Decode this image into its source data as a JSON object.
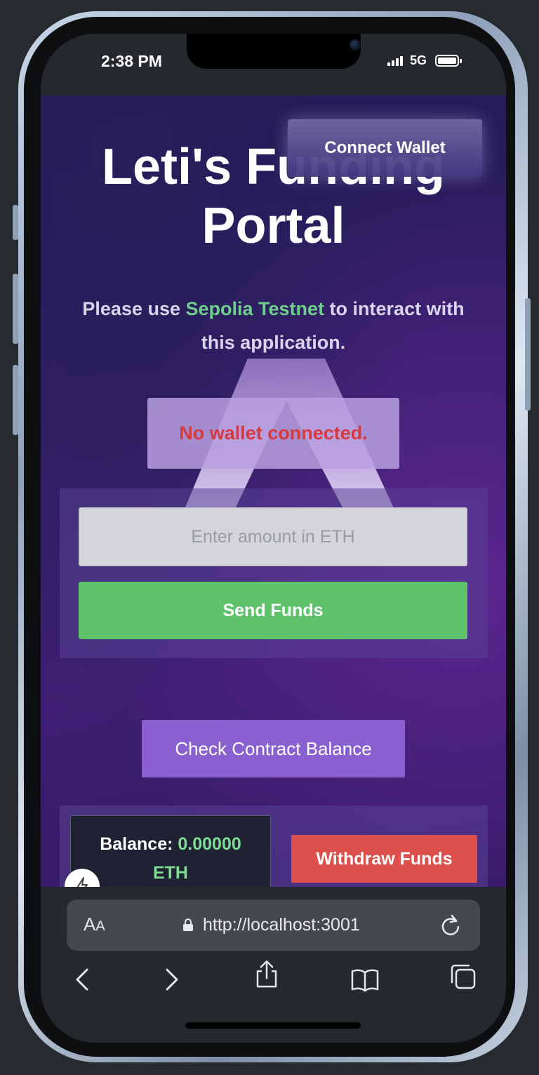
{
  "status_bar": {
    "time": "2:38 PM",
    "network": "5G",
    "signal_icon": "cellular-signal-icon",
    "battery_icon": "battery-icon"
  },
  "header": {
    "connect_wallet_label": "Connect Wallet",
    "title": "Leti's Funding Portal"
  },
  "network_note": {
    "prefix": "Please use ",
    "network_name": "Sepolia Testnet",
    "suffix": " to interact with this application."
  },
  "wallet_status": "No wallet connected.",
  "send_form": {
    "amount_placeholder": "Enter amount in ETH",
    "amount_value": "",
    "send_label": "Send Funds"
  },
  "check_balance_label": "Check Contract Balance",
  "balance": {
    "label": "Balance: ",
    "value": "0.00000",
    "unit": "ETH"
  },
  "withdraw_label": "Withdraw Funds",
  "browser": {
    "text_size_label_big": "A",
    "text_size_label_small": "A",
    "url": "http://localhost:3001",
    "toolbar_icons": [
      "back-icon",
      "forward-icon",
      "share-icon",
      "bookmarks-icon",
      "tabs-icon"
    ]
  },
  "colors": {
    "accent_green": "#5ec36b",
    "testnet_green": "#6dd08a",
    "error_red": "#d7393d",
    "withdraw_red": "#dc4f4b",
    "check_purple": "#8a5fd0"
  }
}
